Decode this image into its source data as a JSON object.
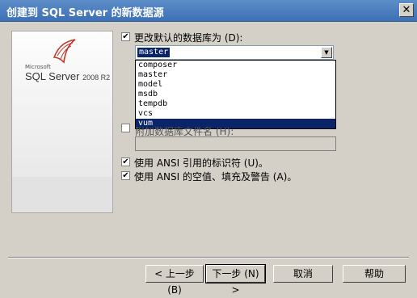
{
  "window": {
    "title": "创建到 SQL Server 的新数据源",
    "close_glyph": "✕"
  },
  "logo": {
    "brand": "Microsoft",
    "name": "SQL Server",
    "version": "2008 R2"
  },
  "options": {
    "change_default_db": {
      "label": "更改默认的数据库为 (D):",
      "checked": true
    },
    "database_combo": {
      "value": "master",
      "arrow_glyph": "▼",
      "options": [
        "composer",
        "master",
        "model",
        "msdb",
        "tempdb",
        "vcs",
        "vum"
      ],
      "highlighted": "vum"
    },
    "attach_db_file": {
      "label": "附加数据库文件名 (H):",
      "checked": false
    },
    "ansi_quoted_identifiers": {
      "label": "使用 ANSI 引用的标识符 (U)。",
      "checked": true
    },
    "ansi_nulls_padding_warnings": {
      "label": "使用 ANSI 的空值、填充及警告 (A)。",
      "checked": true
    }
  },
  "buttons": {
    "back": "< 上一步 (B)",
    "next": "下一步 (N) >",
    "cancel": "取消",
    "help": "帮助"
  },
  "check_glyph": "✔"
}
